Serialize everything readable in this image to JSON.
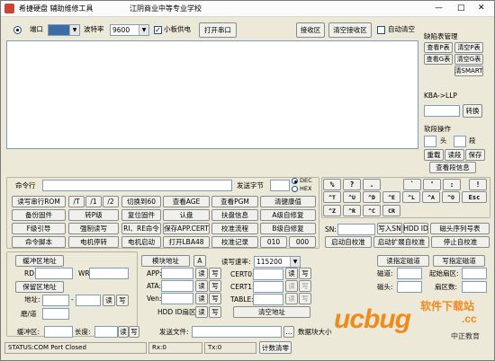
{
  "title": "希捷硬盘 辅助维修工具",
  "org": "江阴商业中等专业学校",
  "window_controls": {
    "minimize": "—",
    "maximize": "□",
    "close": "✕"
  },
  "top": {
    "port_label": "端口",
    "baud_label": "波特率",
    "baud_value": "9600",
    "board_power": "小板供电",
    "open_port": "打开串口",
    "recv_area": "接收区",
    "clear_recv": "清空接收区",
    "auto_clear": "自动清空"
  },
  "right": {
    "defect_title": "缺陷表管理",
    "p_view": "查看P表",
    "p_clear": "清空P表",
    "g_view": "查看G表",
    "g_clear": "清空G表",
    "smart_clear": "清SMART",
    "kba_label": "KBA->LLP",
    "convert": "转换",
    "segment_title": "软段操作",
    "head_label": "头",
    "seg_label": "段",
    "reload": "重载",
    "read_seg": "读段",
    "save": "保存",
    "view_seg_info": "查看段信息"
  },
  "cmd": {
    "label": "命令行",
    "send_bytes": "发送字节",
    "dec": "DEC",
    "hex": "HEX"
  },
  "keys": [
    "%",
    "?",
    ".",
    "`",
    "'",
    ":",
    "!",
    "^T",
    "^U",
    "^D",
    "^E",
    "^L",
    "^A",
    "^O",
    "Esc",
    "^Z",
    "^R",
    "^C",
    "CR"
  ],
  "buttons_row1": [
    "读写串行ROM",
    "/T",
    "/1",
    "/2",
    "切换到60",
    "查看AGE",
    "查看PGM",
    "清键康值"
  ],
  "buttons_row2": [
    "备份固件",
    "转P级",
    "复位固件",
    "认盘",
    "扶盘信息",
    "A级自修复"
  ],
  "buttons_row3": [
    "F级引导",
    "强制读写",
    "RI、RE命令",
    "保存APP.CERT",
    "校准流程",
    "B级自修复"
  ],
  "buttons_row4": [
    "命令脚本",
    "电机停转",
    "电机启动",
    "打开LBA48",
    "校准记录",
    "010",
    "000"
  ],
  "sn": {
    "label": "SN:",
    "write_sn": "写入SN",
    "hdd_id": "HDD ID",
    "head_seq": "磁头序列号表",
    "start_cal": "启动自校准",
    "start_ext": "启动扩展自校准",
    "stop_cal": "停止自校准"
  },
  "bottom": {
    "buf_addr": "缓冲区地址",
    "rd": "RD:",
    "wr": "WR:",
    "keep_buf": "保留区地址",
    "addr": "地址:",
    "cyl": "磨/道",
    "read": "读",
    "write": "写",
    "buf_area": "缓冲区:",
    "length": "长度:",
    "module_addr": "模块地址",
    "a_label": "A",
    "app": "APP:",
    "ata": "ATA:",
    "ven": "Ven:",
    "hdd_id_sector": "HDD ID扇区",
    "rw_speed": "读写速率:",
    "speed_value": "115200",
    "cert0": "CERT0:",
    "cert1": "CERT1:",
    "table": "TABLE:",
    "clear_addr": "清空地址",
    "read_designated": "读指定磁道",
    "write_designated": "写指定磁道",
    "track": "磁道:",
    "start_sector": "起始扇区:",
    "head": "磁头:",
    "sector_count": "扇区数:",
    "send_file": "发送文件:",
    "data_block": "数据块大小"
  },
  "statusbar": {
    "status": "STATUS:COM Port Closed",
    "rx": "Rx:0",
    "tx": "Tx:0",
    "reset_count": "计数清零"
  },
  "watermark": {
    "brand": "ucbug",
    "site": "软件下载站",
    "tagline": "中正教育",
    "com": ".cc"
  },
  "colors": {
    "accent": "#3a6ea5",
    "watermark": "#f08a1c"
  }
}
